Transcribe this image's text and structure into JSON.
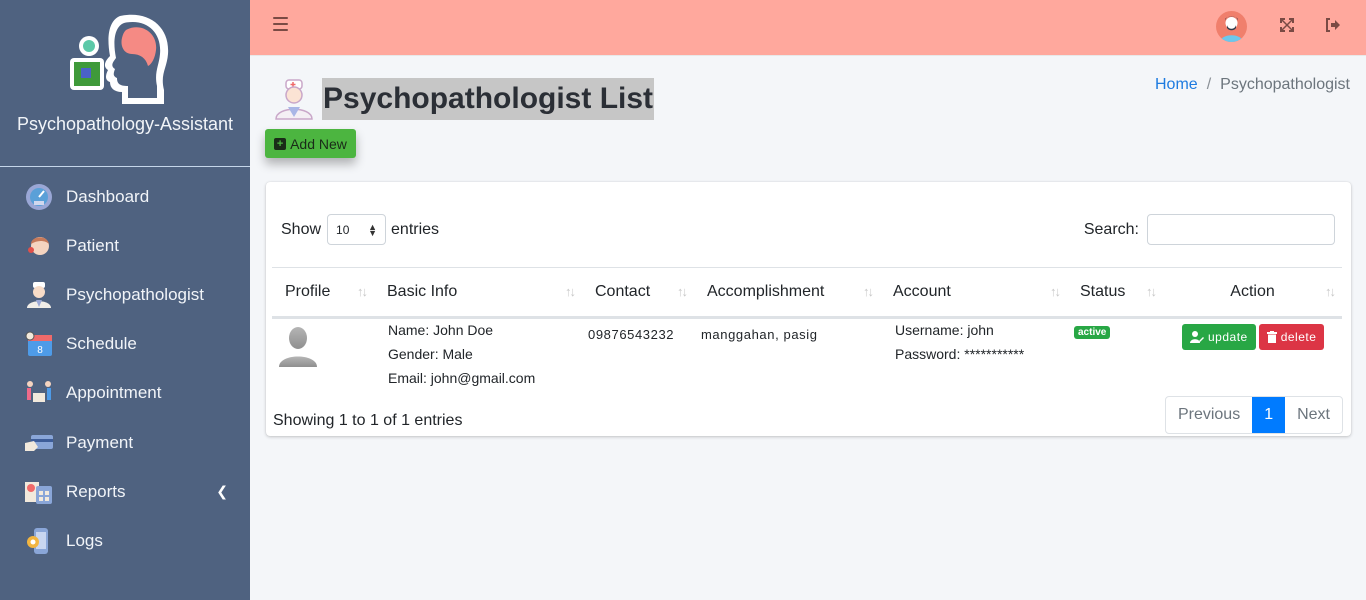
{
  "app": {
    "brand_name": "Psychopathology-Assistant"
  },
  "sidebar": {
    "items": [
      {
        "label": "Dashboard",
        "icon": "dashboard-gauge-icon"
      },
      {
        "label": "Patient",
        "icon": "patient-icon"
      },
      {
        "label": "Psychopathologist",
        "icon": "doctor-icon"
      },
      {
        "label": "Schedule",
        "icon": "calendar-icon"
      },
      {
        "label": "Appointment",
        "icon": "appointment-icon"
      },
      {
        "label": "Payment",
        "icon": "payment-card-icon"
      },
      {
        "label": "Reports",
        "icon": "reports-icon",
        "has_submenu": true
      },
      {
        "label": "Logs",
        "icon": "logs-icon"
      }
    ]
  },
  "topbar": {
    "menu_icon": "hamburger-icon",
    "user_avatar": "user-avatar",
    "fullscreen_icon": "expand-icon",
    "logout_icon": "logout-icon"
  },
  "page": {
    "title": "Psychopathologist List",
    "breadcrumb": {
      "home": "Home",
      "separator": "/",
      "current": "Psychopathologist"
    },
    "add_button": "Add New"
  },
  "table_controls": {
    "show_label": "Show",
    "entries_label": "entries",
    "page_length": "10",
    "search_label": "Search:",
    "search_value": ""
  },
  "table": {
    "columns": [
      "Profile",
      "Basic Info",
      "Contact",
      "Accomplishment",
      "Account",
      "Status",
      "Action"
    ],
    "rows": [
      {
        "name": "Name: John Doe",
        "gender": "Gender: Male",
        "email": "Email: john@gmail.com",
        "contact": "09876543232",
        "accomplishment": "manggahan, pasig",
        "username": "Username: john",
        "password": "Password: ***********",
        "status": "active",
        "update_label": "update",
        "delete_label": "delete"
      }
    ]
  },
  "footer": {
    "info": "Showing 1 to 1 of 1 entries",
    "pager": {
      "previous": "Previous",
      "current": "1",
      "next": "Next"
    }
  },
  "colors": {
    "sidebar_bg": "#4f6280",
    "topbar_bg": "#ffa89d",
    "success": "#28a745",
    "danger": "#dc3545",
    "primary": "#007bff",
    "add_button": "#4cb540"
  }
}
